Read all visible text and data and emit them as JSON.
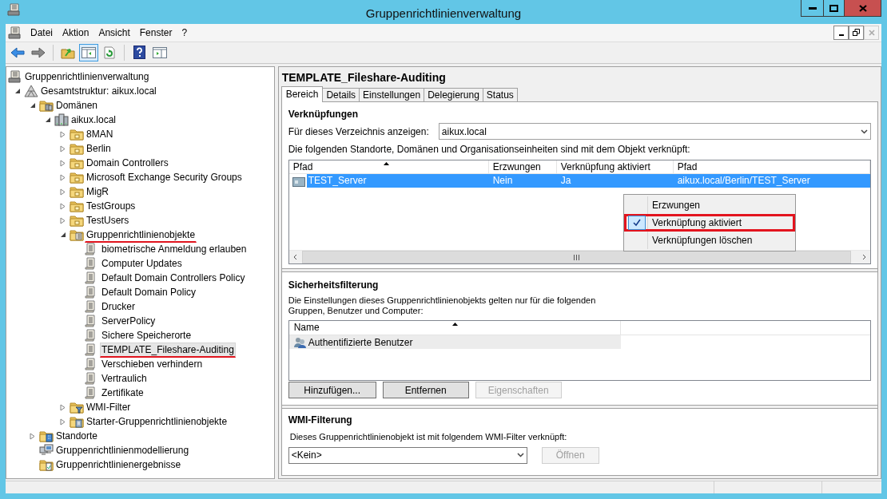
{
  "window": {
    "title": "Gruppenrichtlinienverwaltung"
  },
  "menu": [
    "Datei",
    "Aktion",
    "Ansicht",
    "Fenster",
    "?"
  ],
  "toolbar": [
    {
      "kind": "back",
      "pressed": false
    },
    {
      "kind": "forward",
      "pressed": false
    },
    {
      "kind": "up",
      "pressed": false
    },
    {
      "kind": "console_tree",
      "pressed": true
    },
    {
      "kind": "refresh",
      "pressed": false
    },
    {
      "kind": "help",
      "pressed": false
    },
    {
      "kind": "action_pane",
      "pressed": false
    }
  ],
  "tree": [
    {
      "label": "Gruppenrichtlinienverwaltung",
      "kind": "root",
      "selected": false,
      "children": [
        {
          "label": "Gesamtstruktur: aikux.local",
          "kind": "forest",
          "expanded": true,
          "selected": false,
          "children": [
            {
              "label": "Domänen",
              "kind": "domains",
              "expanded": true,
              "selected": false,
              "children": [
                {
                  "label": "aikux.local",
                  "kind": "domain",
                  "expanded": true,
                  "selected": false,
                  "children": [
                    {
                      "label": "8MAN",
                      "kind": "ou",
                      "expanded": false,
                      "selected": false
                    },
                    {
                      "label": "Berlin",
                      "kind": "ou",
                      "expanded": false,
                      "selected": false
                    },
                    {
                      "label": "Domain Controllers",
                      "kind": "ou",
                      "expanded": false,
                      "selected": false
                    },
                    {
                      "label": "Microsoft Exchange Security Groups",
                      "kind": "ou",
                      "expanded": false,
                      "selected": false
                    },
                    {
                      "label": "MigR",
                      "kind": "ou",
                      "expanded": false,
                      "selected": false
                    },
                    {
                      "label": "TestGroups",
                      "kind": "ou",
                      "expanded": false,
                      "selected": false
                    },
                    {
                      "label": "TestUsers",
                      "kind": "ou",
                      "expanded": false,
                      "selected": false
                    },
                    {
                      "label": "Gruppenrichtlinienobjekte",
                      "kind": "gpo_folder",
                      "expanded": true,
                      "selected": false,
                      "underlined": true,
                      "children": [
                        {
                          "label": "biometrische Anmeldung erlauben",
                          "kind": "gpo",
                          "selected": false
                        },
                        {
                          "label": "Computer Updates",
                          "kind": "gpo",
                          "selected": false
                        },
                        {
                          "label": "Default Domain Controllers Policy",
                          "kind": "gpo",
                          "selected": false
                        },
                        {
                          "label": "Default Domain Policy",
                          "kind": "gpo",
                          "selected": false
                        },
                        {
                          "label": "Drucker",
                          "kind": "gpo",
                          "selected": false
                        },
                        {
                          "label": "ServerPolicy",
                          "kind": "gpo",
                          "selected": false
                        },
                        {
                          "label": "Sichere Speicherorte",
                          "kind": "gpo",
                          "selected": false
                        },
                        {
                          "label": "TEMPLATE_Fileshare-Auditing",
                          "kind": "gpo",
                          "selected": true,
                          "underlined": true
                        },
                        {
                          "label": "Verschieben verhindern",
                          "kind": "gpo",
                          "selected": false
                        },
                        {
                          "label": "Vertraulich",
                          "kind": "gpo",
                          "selected": false
                        },
                        {
                          "label": "Zertifikate",
                          "kind": "gpo",
                          "selected": false
                        }
                      ]
                    },
                    {
                      "label": "WMI-Filter",
                      "kind": "wmi",
                      "expanded": false,
                      "selected": false
                    },
                    {
                      "label": "Starter-Gruppenrichtlinienobjekte",
                      "kind": "starter",
                      "expanded": false,
                      "selected": false
                    }
                  ]
                }
              ]
            },
            {
              "label": "Standorte",
              "kind": "sites",
              "expanded": false,
              "selected": false
            },
            {
              "label": "Gruppenrichtlinienmodellierung",
              "kind": "modeling",
              "selected": false
            },
            {
              "label": "Gruppenrichtlinienergebnisse",
              "kind": "results",
              "selected": false
            }
          ]
        }
      ]
    }
  ],
  "detail": {
    "title": "TEMPLATE_Fileshare-Auditing",
    "tabs": [
      {
        "label": "Bereich",
        "selected": true
      },
      {
        "label": "Details",
        "selected": false
      },
      {
        "label": "Einstellungen",
        "selected": false
      },
      {
        "label": "Delegierung",
        "selected": false
      },
      {
        "label": "Status",
        "selected": false
      }
    ],
    "links": {
      "heading": "Verknüpfungen",
      "scope_label": "Für dieses Verzeichnis anzeigen:",
      "scope_value": "aikux.local",
      "description": "Die folgenden Standorte, Domänen und Organisationseinheiten sind mit dem Objekt verknüpft:",
      "columns": [
        "Pfad",
        "Erzwungen",
        "Verknüpfung aktiviert",
        "Pfad"
      ],
      "rows": [
        {
          "selected": true,
          "cells": [
            "TEST_Server",
            "Nein",
            "Ja",
            "aikux.local/Berlin/TEST_Server"
          ]
        }
      ]
    },
    "context_menu": [
      {
        "label": "Erzwungen",
        "checked": false,
        "outlined": false
      },
      {
        "label": "Verknüpfung aktiviert",
        "checked": true,
        "outlined": true
      },
      {
        "label": "Verknüpfungen löschen",
        "checked": false,
        "outlined": false
      }
    ],
    "security": {
      "heading": "Sicherheitsfilterung",
      "description": "Die Einstellungen dieses Gruppenrichtlinienobjekts gelten nur für die folgenden Gruppen, Benutzer und Computer:",
      "columns": [
        "Name"
      ],
      "rows": [
        {
          "selected": true,
          "name": "Authentifizierte Benutzer"
        }
      ],
      "buttons": [
        {
          "label": "Hinzufügen...",
          "disabled": false
        },
        {
          "label": "Entfernen",
          "disabled": false
        },
        {
          "label": "Eigenschaften",
          "disabled": true
        }
      ]
    },
    "wmi": {
      "heading": "WMI-Filterung",
      "description": "Dieses Gruppenrichtlinienobjekt ist mit folgendem WMI-Filter verknüpft:",
      "value": "<Kein>",
      "button": {
        "label": "Öffnen",
        "disabled": true
      }
    }
  }
}
